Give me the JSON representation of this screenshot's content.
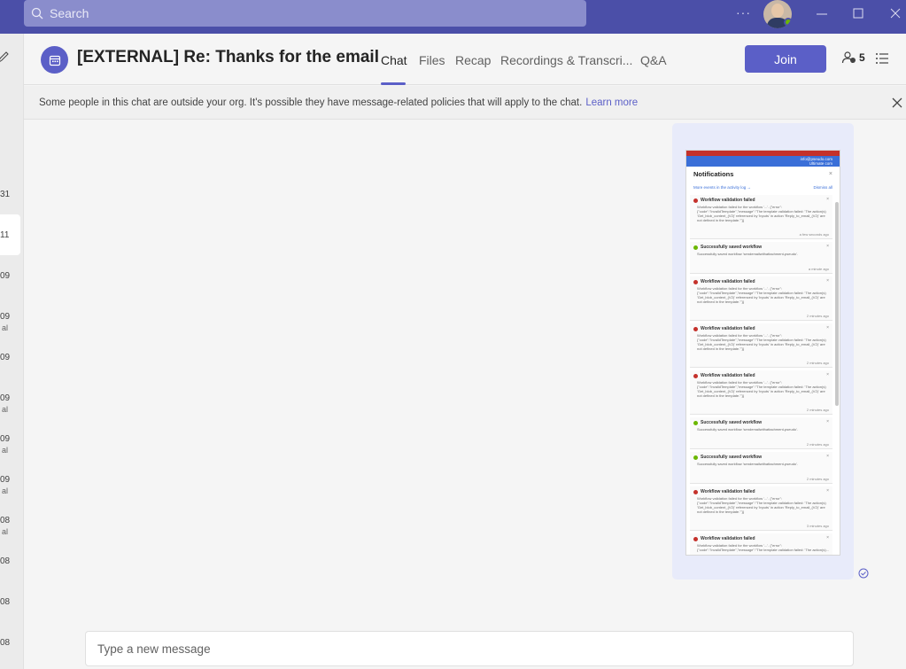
{
  "titlebar": {
    "search_placeholder": "Search",
    "more_label": "···"
  },
  "leftrail": {
    "items": [
      {
        "top": "31",
        "sub": ""
      },
      {
        "top": "11",
        "sub": ""
      },
      {
        "top": "09",
        "sub": ""
      },
      {
        "top": "09",
        "sub": "al"
      },
      {
        "top": "09",
        "sub": ""
      },
      {
        "top": "09",
        "sub": "al"
      },
      {
        "top": "09",
        "sub": "al"
      },
      {
        "top": "09",
        "sub": "al"
      },
      {
        "top": "08",
        "sub": "al"
      },
      {
        "top": "08",
        "sub": ""
      },
      {
        "top": "08",
        "sub": ""
      },
      {
        "top": "08",
        "sub": ""
      }
    ]
  },
  "header": {
    "title": "[EXTERNAL] Re: Thanks for the email",
    "tabs": [
      "Chat",
      "Files",
      "Recap",
      "Recordings & Transcri...",
      "Q&A"
    ],
    "active_tab": "Chat",
    "join_label": "Join",
    "participant_count": "5"
  },
  "banner": {
    "text": "Some people in this chat are outside your org. It's possible they have message-related policies that will apply to the chat.",
    "link_text": "Learn more"
  },
  "message": {
    "screenshot": {
      "header_tag": "info@pseudo.com",
      "header_tag2": "Ultimate com",
      "title": "Notifications",
      "more_events": "More events in the activity log →",
      "dismiss_all": "Dismiss all",
      "notifications": [
        {
          "status": "error",
          "title": "Workflow validation failed",
          "body": "Workflow validation failed for the workflow '...'. {\"error\": {\"code\":\"InvalidTemplate\",\"message\":\"The template validation failed: 'The action(s) 'Get_blob_content_(V2)' referenced by 'inputs' in action 'Reply_to_email_(V2)' are not defined in the template.'\"}}",
          "time": "a few seconds ago"
        },
        {
          "status": "success",
          "title": "Successfully saved workflow",
          "body": "Successfully saved workflow 'sendemailwithattachment-pseudo'.",
          "time": "a minute ago"
        },
        {
          "status": "error",
          "title": "Workflow validation failed",
          "body": "Workflow validation failed for the workflow '...'. {\"error\": {\"code\":\"InvalidTemplate\",\"message\":\"The template validation failed: 'The action(s) 'Get_blob_content_(V2)' referenced by 'inputs' in action 'Reply_to_email_(V2)' are not defined in the template.'\"}}",
          "time": "2 minutes ago"
        },
        {
          "status": "error",
          "title": "Workflow validation failed",
          "body": "Workflow validation failed for the workflow '...'. {\"error\": {\"code\":\"InvalidTemplate\",\"message\":\"The template validation failed: 'The action(s) 'Get_blob_content_(V2)' referenced by 'inputs' in action 'Reply_to_email_(V2)' are not defined in the template.'\"}}",
          "time": "2 minutes ago"
        },
        {
          "status": "error",
          "title": "Workflow validation failed",
          "body": "Workflow validation failed for the workflow '...'. {\"error\": {\"code\":\"InvalidTemplate\",\"message\":\"The template validation failed: 'The action(s) 'Get_blob_content_(V2)' referenced by 'inputs' in action 'Reply_to_email_(V2)' are not defined in the template.'\"}}",
          "time": "2 minutes ago"
        },
        {
          "status": "success",
          "title": "Successfully saved workflow",
          "body": "Successfully saved workflow 'sendemailwithattachment-pseudo'.",
          "time": "2 minutes ago"
        },
        {
          "status": "success",
          "title": "Successfully saved workflow",
          "body": "Successfully saved workflow 'sendemailwithattachment-pseudo'.",
          "time": "2 minutes ago"
        },
        {
          "status": "error",
          "title": "Workflow validation failed",
          "body": "Workflow validation failed for the workflow '...'. {\"error\": {\"code\":\"InvalidTemplate\",\"message\":\"The template validation failed: 'The action(s) 'Get_blob_content_(V2)' referenced by 'inputs' in action 'Reply_to_email_(V2)' are not defined in the template.'\"}}",
          "time": "3 minutes ago"
        },
        {
          "status": "error",
          "title": "Workflow validation failed",
          "body": "Workflow validation failed for the workflow '...'. {\"error\": {\"code\":\"InvalidTemplate\",\"message\":\"The template validation failed: 'The action(s)...",
          "time": ""
        }
      ]
    }
  },
  "composer": {
    "placeholder": "Type a new message"
  },
  "colors": {
    "brand": "#5b5fc7",
    "titlebar": "#4b4fa8",
    "error": "#c4312b",
    "success": "#6bb700"
  }
}
